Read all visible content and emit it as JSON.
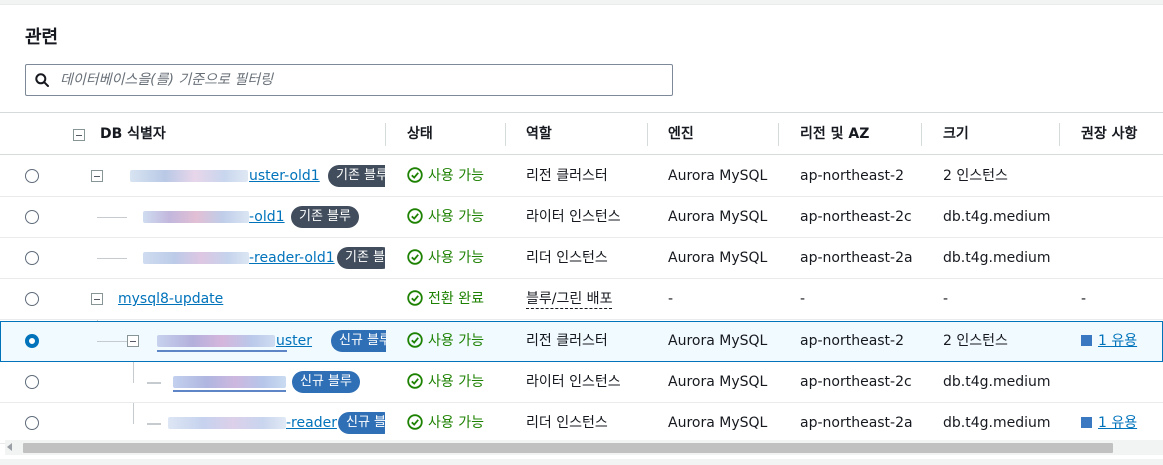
{
  "section": {
    "title": "관련"
  },
  "search": {
    "placeholder": "데이터베이스을(를) 기준으로 필터링"
  },
  "columns": {
    "db_id": "DB 식별자",
    "status": "상태",
    "role": "역할",
    "engine": "엔진",
    "region": "리전 및 AZ",
    "size": "크기",
    "recommendations": "권장 사항"
  },
  "rows": [
    {
      "id_suffix": "uster-old1",
      "badge": "기존 블루",
      "status": "사용 가능",
      "role": "리전 클러스터",
      "engine": "Aurora MySQL",
      "region": "ap-northeast-2",
      "size": "2 인스턴스",
      "rec": ""
    },
    {
      "id_suffix": "-old1",
      "badge": "기존 블루",
      "status": "사용 가능",
      "role": "라이터 인스턴스",
      "engine": "Aurora MySQL",
      "region": "ap-northeast-2c",
      "size": "db.t4g.medium",
      "rec": ""
    },
    {
      "id_suffix": "-reader-old1",
      "badge": "기존 블",
      "status": "사용 가능",
      "role": "리더 인스턴스",
      "engine": "Aurora MySQL",
      "region": "ap-northeast-2a",
      "size": "db.t4g.medium",
      "rec": ""
    },
    {
      "id_suffix": "mysql8-update",
      "badge": "",
      "status": "전환 완료",
      "role": "블루/그린 배포",
      "engine": "-",
      "region": "-",
      "size": "-",
      "rec": "-"
    },
    {
      "id_suffix": "uster",
      "badge": "신규 블루",
      "status": "사용 가능",
      "role": "리전 클러스터",
      "engine": "Aurora MySQL",
      "region": "ap-northeast-2",
      "size": "2 인스턴스",
      "rec": "1 유용"
    },
    {
      "id_suffix": "",
      "badge": "신규 블루",
      "status": "사용 가능",
      "role": "라이터 인스턴스",
      "engine": "Aurora MySQL",
      "region": "ap-northeast-2c",
      "size": "db.t4g.medium",
      "rec": ""
    },
    {
      "id_suffix": "-reader",
      "badge": "신규 블",
      "status": "사용 가능",
      "role": "리더 인스턴스",
      "engine": "Aurora MySQL",
      "region": "ap-northeast-2a",
      "size": "db.t4g.medium",
      "rec": "1 유용"
    }
  ],
  "colors": {
    "link": "#0073bb",
    "ok": "#1d8102",
    "badge_gray": "#414d5c",
    "badge_blue": "#2f6fb5",
    "selected_border": "#0073bb"
  }
}
